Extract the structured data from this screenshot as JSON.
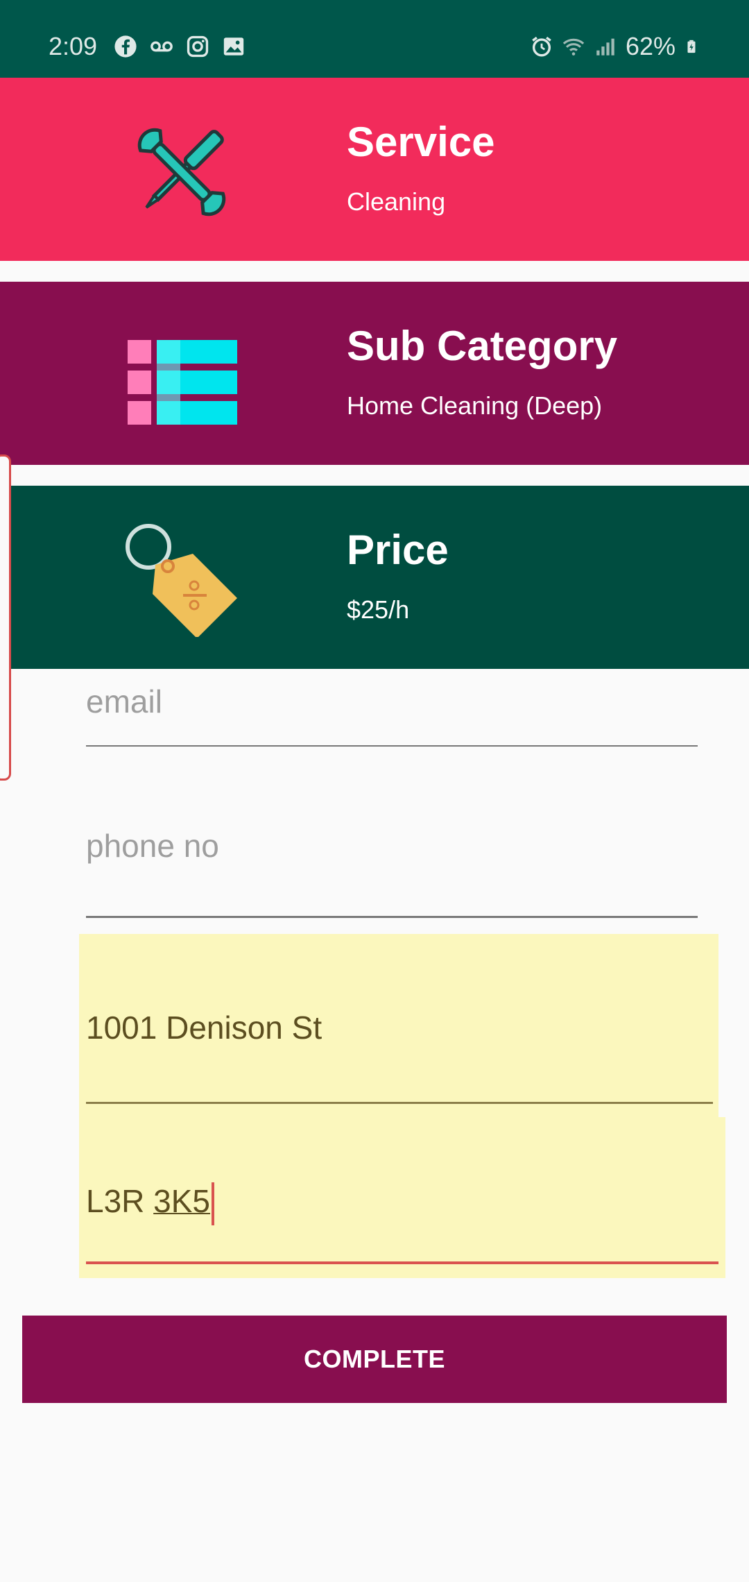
{
  "status_bar": {
    "time": "2:09",
    "battery": "62%",
    "left_icons": [
      "facebook-icon",
      "voicemail-icon",
      "instagram-icon",
      "image-icon"
    ],
    "right_icons": [
      "alarm-icon",
      "wifi-icon",
      "signal-icon",
      "battery-icon"
    ]
  },
  "cards": {
    "service": {
      "title": "Service",
      "value": "Cleaning",
      "color": "#f22b5b"
    },
    "sub_category": {
      "title": "Sub Category",
      "value": "Home Cleaning (Deep)",
      "color": "#880e4f"
    },
    "price": {
      "title": "Price",
      "value": "$25/h",
      "color": "#004d40"
    }
  },
  "form": {
    "email": {
      "placeholder": "email",
      "value": ""
    },
    "phone": {
      "placeholder": "phone no",
      "value": ""
    },
    "address": {
      "value": "1001 Denison St"
    },
    "postal": {
      "value_prefix": "L3R ",
      "value_underlined": "3K5"
    },
    "complete_label": "COMPLETE"
  }
}
